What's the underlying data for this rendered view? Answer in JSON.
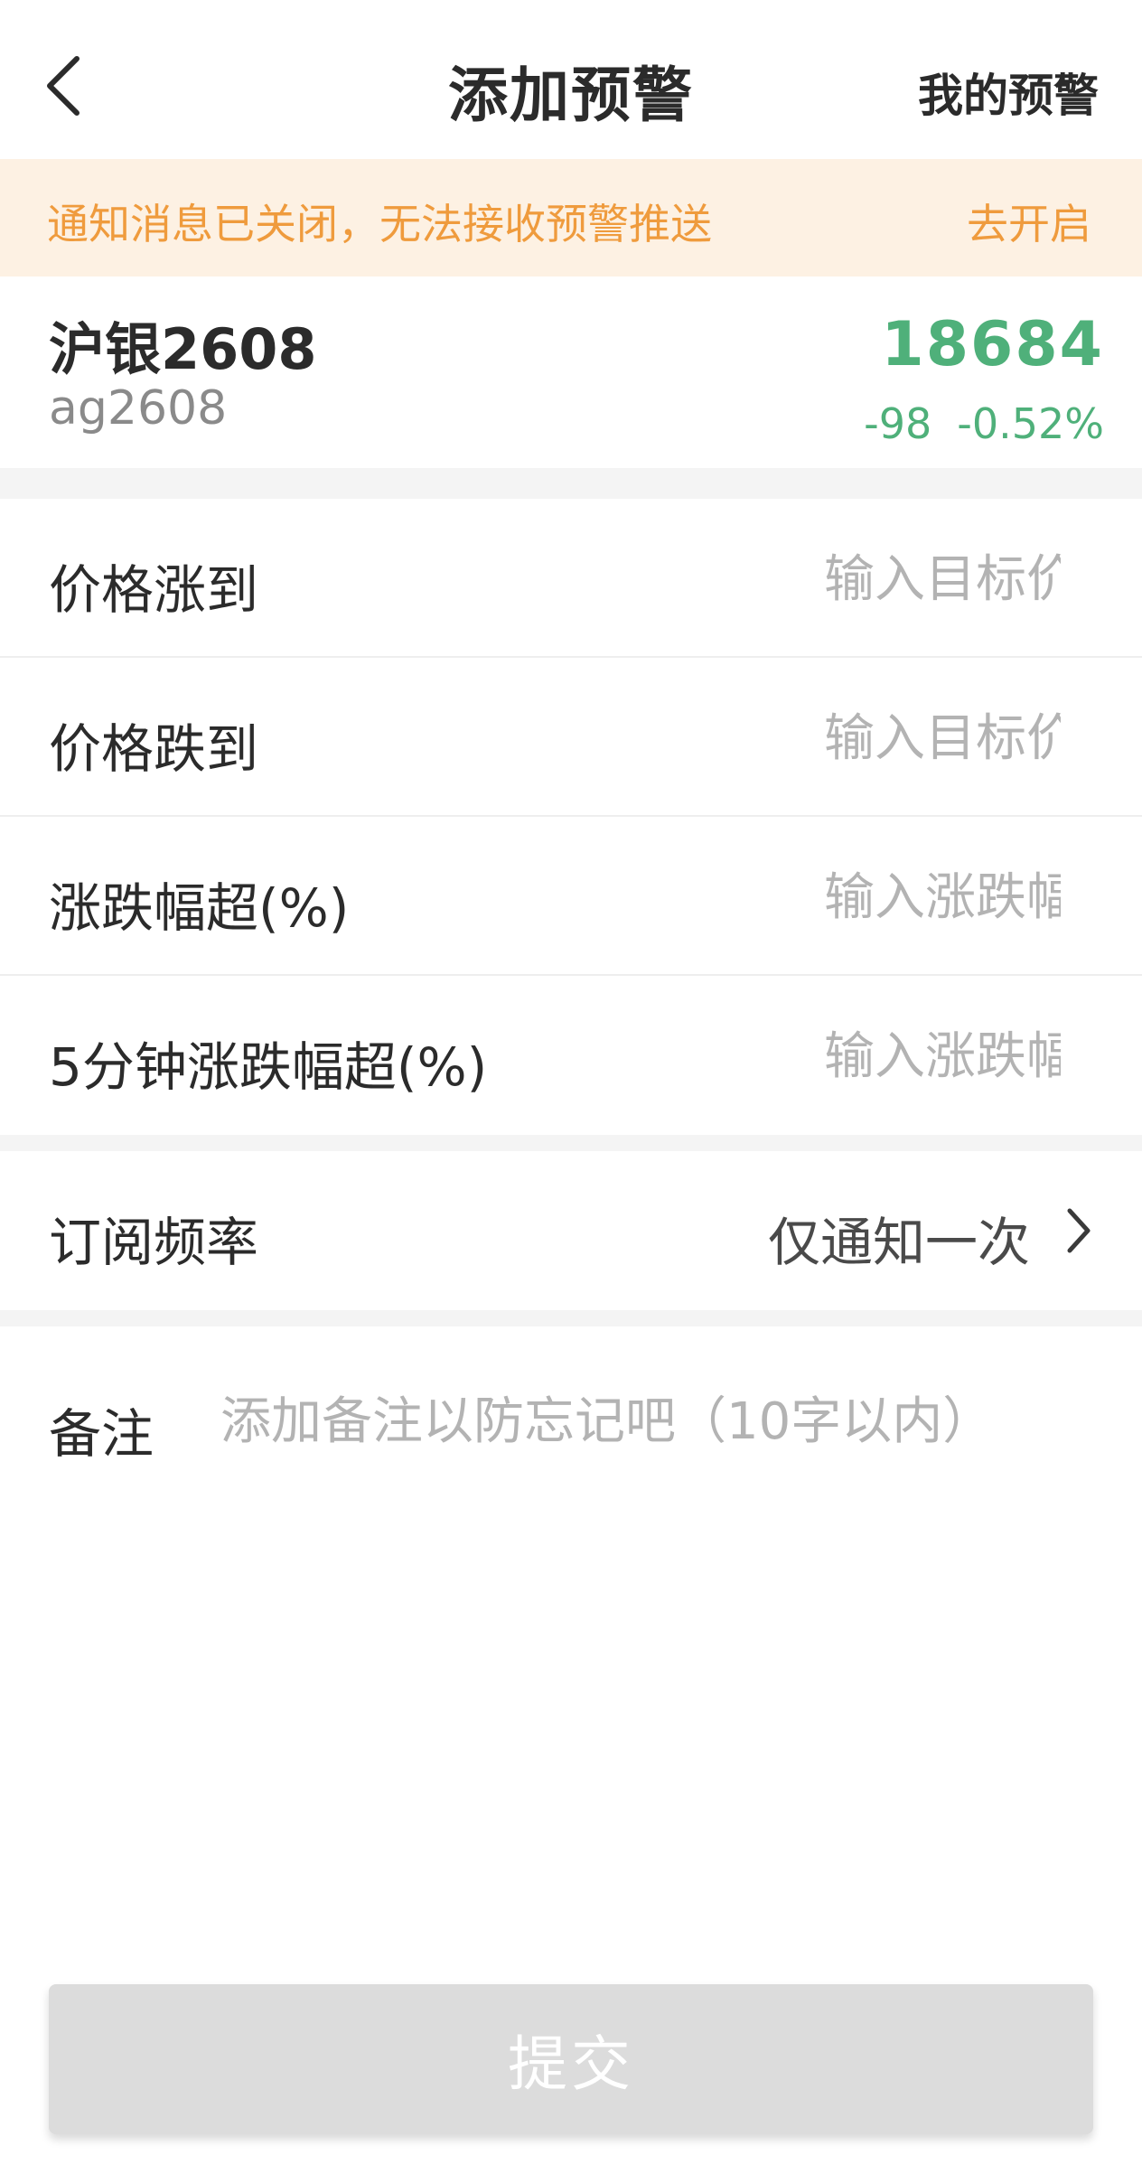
{
  "header": {
    "back_icon": "chevron-left-icon",
    "title": "添加预警",
    "my_alerts_label": "我的预警"
  },
  "notice": {
    "message": "通知消息已关闭，无法接收预警推送",
    "action_label": "去开启",
    "color": "#ef9b3d",
    "background": "#fdf1e3"
  },
  "instrument": {
    "name": "沪银2608",
    "code": "ag2608",
    "price": "18684",
    "change": "-98",
    "change_pct": "-0.52%",
    "trend_color": "#4fb07a"
  },
  "conditions": [
    {
      "label": "价格涨到",
      "placeholder": "输入目标价",
      "value": ""
    },
    {
      "label": "价格跌到",
      "placeholder": "输入目标价",
      "value": ""
    },
    {
      "label": "涨跌幅超(%)",
      "placeholder": "输入涨跌幅",
      "value": ""
    },
    {
      "label": "5分钟涨跌幅超(%)",
      "placeholder": "输入涨跌幅",
      "value": ""
    }
  ],
  "frequency": {
    "label": "订阅频率",
    "value": "仅通知一次",
    "icon": "chevron-right-icon"
  },
  "note": {
    "label": "备注",
    "placeholder": "添加备注以防忘记吧（10字以内）",
    "value": ""
  },
  "submit": {
    "label": "提交",
    "state": "disabled"
  }
}
